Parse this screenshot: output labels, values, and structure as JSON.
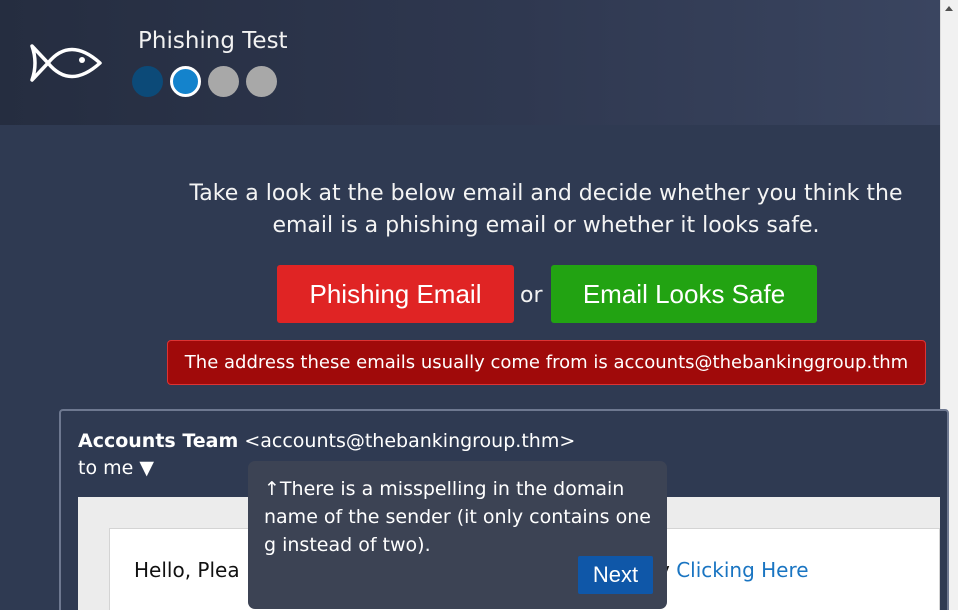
{
  "header": {
    "title": "Phishing Test",
    "icon": "fish-icon",
    "progress": {
      "total_steps": 4,
      "current_step": 2,
      "completed_steps": 1
    }
  },
  "main": {
    "instructions": "Take a look at the below email and decide whether you think the email is a phishing email or whether it looks safe.",
    "phishing_button": "Phishing Email",
    "or_text": "or",
    "safe_button": "Email Looks Safe",
    "hint_banner": "The address these emails usually come from is accounts@thebankinggroup.thm"
  },
  "email": {
    "sender_name": "Accounts Team",
    "sender_address": "<accounts@thebankingroup.thm>",
    "recipient_line": "to me ▼",
    "body_visible_start": "Hello, Plea",
    "body_visible_end": "y",
    "body_link": "Clicking Here"
  },
  "tooltip": {
    "text": "↑There is a misspelling in the domain name of the sender (it only contains one g instead of two).",
    "next_label": "Next"
  },
  "colors": {
    "background": "#2f3a52",
    "phishing": "#e02424",
    "safe": "#22a312",
    "banner": "#a00a0a",
    "accent": "#1483cc",
    "link": "#1a75c2"
  }
}
